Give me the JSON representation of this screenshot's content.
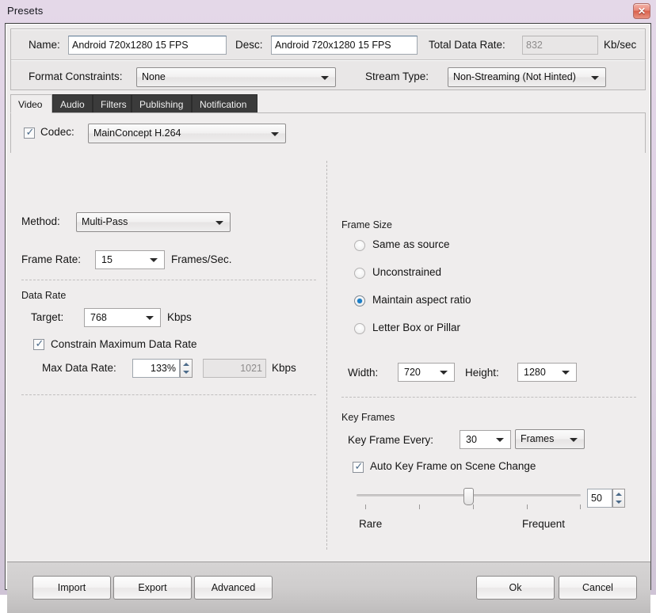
{
  "window": {
    "title": "Presets",
    "close_label": "✕"
  },
  "meta": {
    "name_label": "Name:",
    "name_value": "Android 720x1280 15 FPS",
    "desc_label": "Desc:",
    "desc_value": "Android 720x1280 15 FPS",
    "total_data_rate_label": "Total Data Rate:",
    "total_data_rate_value": "832",
    "total_data_rate_unit": "Kb/sec",
    "format_constraints_label": "Format Constraints:",
    "format_constraints_value": "None",
    "stream_type_label": "Stream Type:",
    "stream_type_value": "Non-Streaming (Not Hinted)"
  },
  "tabs": [
    {
      "label": "Video",
      "active": true
    },
    {
      "label": "Audio",
      "active": false
    },
    {
      "label": "Filters",
      "active": false
    },
    {
      "label": "Publishing",
      "active": false
    },
    {
      "label": "Notification",
      "active": false
    }
  ],
  "codec": {
    "label": "Codec:",
    "checked": true,
    "value": "MainConcept H.264"
  },
  "left": {
    "method_label": "Method:",
    "method_value": "Multi-Pass",
    "frame_rate_label": "Frame Rate:",
    "frame_rate_value": "15",
    "frame_rate_unit": "Frames/Sec.",
    "data_rate_group": "Data Rate",
    "target_label": "Target:",
    "target_value": "768",
    "target_unit": "Kbps",
    "constrain_label": "Constrain Maximum Data Rate",
    "constrain_checked": true,
    "max_data_rate_label": "Max Data Rate:",
    "max_data_rate_percent": "133%",
    "max_data_rate_value": "1021",
    "max_data_rate_unit": "Kbps"
  },
  "right": {
    "frame_size_group": "Frame Size",
    "frame_size_options": [
      {
        "label": "Same as source",
        "selected": false
      },
      {
        "label": "Unconstrained",
        "selected": false
      },
      {
        "label": "Maintain aspect ratio",
        "selected": true
      },
      {
        "label": "Letter Box or Pillar",
        "selected": false
      }
    ],
    "width_label": "Width:",
    "width_value": "720",
    "height_label": "Height:",
    "height_value": "1280",
    "key_frames_group": "Key Frames",
    "key_frame_every_label": "Key Frame Every:",
    "key_frame_every_value": "30",
    "key_frame_unit_value": "Frames",
    "auto_key_frame_label": "Auto Key Frame on Scene Change",
    "auto_key_frame_checked": true,
    "slider_value": "50",
    "slider_min_label": "Rare",
    "slider_max_label": "Frequent"
  },
  "buttons": {
    "import": "Import",
    "export": "Export",
    "advanced": "Advanced",
    "ok": "Ok",
    "cancel": "Cancel"
  },
  "colors": {
    "accent": "#1a7ec8",
    "tab_inactive_bg": "#3b3b3b",
    "panel_bg": "#efeded",
    "close_red": "#d9604c"
  }
}
